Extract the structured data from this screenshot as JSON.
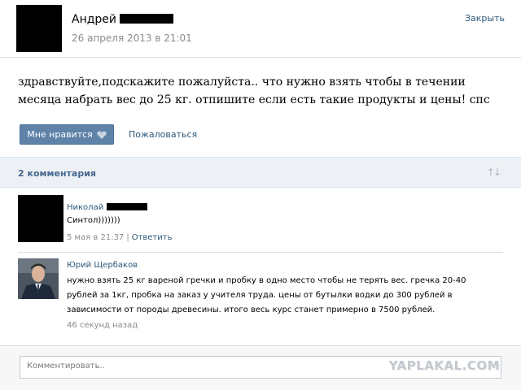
{
  "post": {
    "author": "Андрей",
    "date": "26 апреля 2013 в 21:01",
    "close_label": "Закрыть",
    "text": "здравствуйте,подскажите пожалуйста.. что нужно взять чтобы в течении месяца набрать вес до 25 кг. отпишите если есть такие продукты и цены! спс",
    "like_label": "Мне нравится",
    "report_label": "Пожаловаться"
  },
  "comments_header": {
    "count_label": "2 комментария",
    "sort_icon": "sort-arrows-icon"
  },
  "comments": [
    {
      "author": "Николай",
      "text": "Синтол)))))))",
      "time": "5 мая в 21:37",
      "reply_label": "Ответить"
    },
    {
      "author": "Юрий Щербаков",
      "text_line1": "нужно взять 25 кг вареной гречки и пробку в одно место чтобы не терять вес. гречка 20-40",
      "text_line2": "рублей за 1кг, пробка на заказ у учителя труда. цены от бутылки водки до 300 рублей в",
      "text_line3": "зависимости от породы древесины. итого весь курс станет примерно в 7500 рублей.",
      "time": "46 секунд назад"
    }
  ],
  "comment_input": {
    "placeholder": "Комментировать.."
  },
  "watermark": "YAPLAKAL.COM",
  "colors": {
    "link": "#2b587a",
    "button": "#5e82a8",
    "bar_bg": "#edf1f5",
    "meta": "#8b8b8b"
  }
}
